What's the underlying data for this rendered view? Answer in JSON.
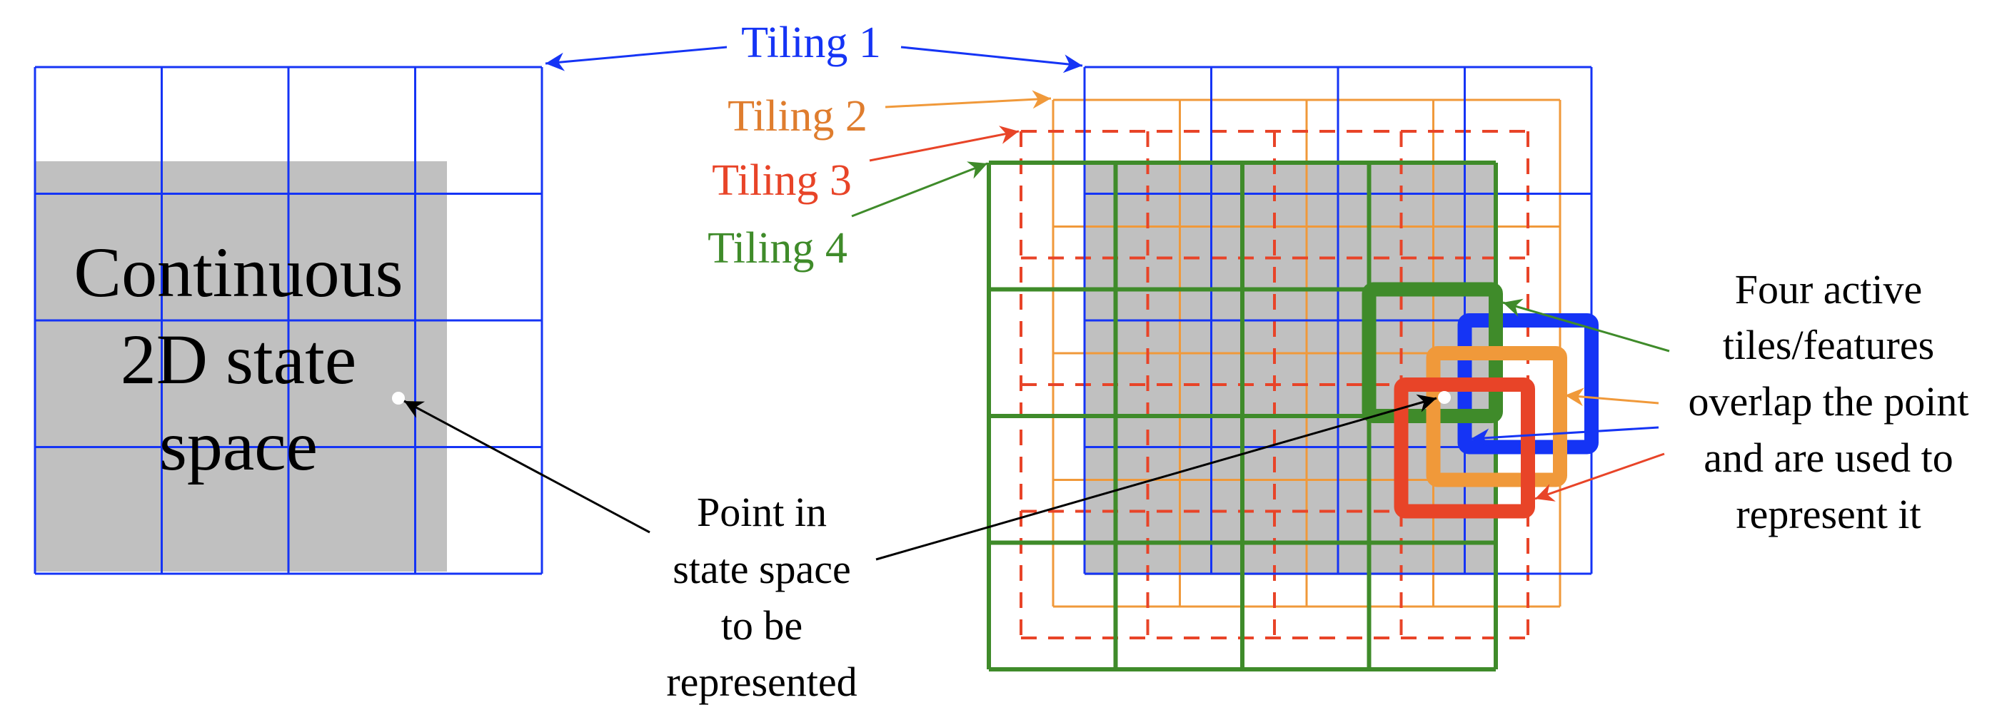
{
  "colors": {
    "tiling1": "#1534f5",
    "tiling2": "#f0993a",
    "tiling2_text": "#df7d2e",
    "tiling3": "#e84428",
    "tiling4": "#3f8b2a",
    "state_space_fill": "#c0c0c0",
    "text": "#000000",
    "point": "#ffffff"
  },
  "left_panel": {
    "label_lines": [
      "Continuous",
      "2D state",
      "space"
    ],
    "grid": {
      "rows": 4,
      "cols": 4
    }
  },
  "tilings": [
    {
      "id": "tiling1",
      "label": "Tiling 1",
      "style": "solid",
      "rows": 4,
      "cols": 4,
      "active_cell": {
        "row": 2,
        "col": 3
      }
    },
    {
      "id": "tiling2",
      "label": "Tiling 2",
      "style": "solid",
      "rows": 4,
      "cols": 4,
      "active_cell": {
        "row": 2,
        "col": 3
      }
    },
    {
      "id": "tiling3",
      "label": "Tiling 3",
      "style": "dashed",
      "rows": 4,
      "cols": 4,
      "active_cell": {
        "row": 2,
        "col": 3
      }
    },
    {
      "id": "tiling4",
      "label": "Tiling 4",
      "style": "solid",
      "rows": 4,
      "cols": 4,
      "active_cell": {
        "row": 1,
        "col": 3
      }
    }
  ],
  "point_caption_lines": [
    "Point in",
    "state space",
    "to be",
    "represented"
  ],
  "active_caption_lines": [
    "Four active",
    "tiles/features",
    "overlap the point",
    "and are used to",
    "represent it"
  ]
}
